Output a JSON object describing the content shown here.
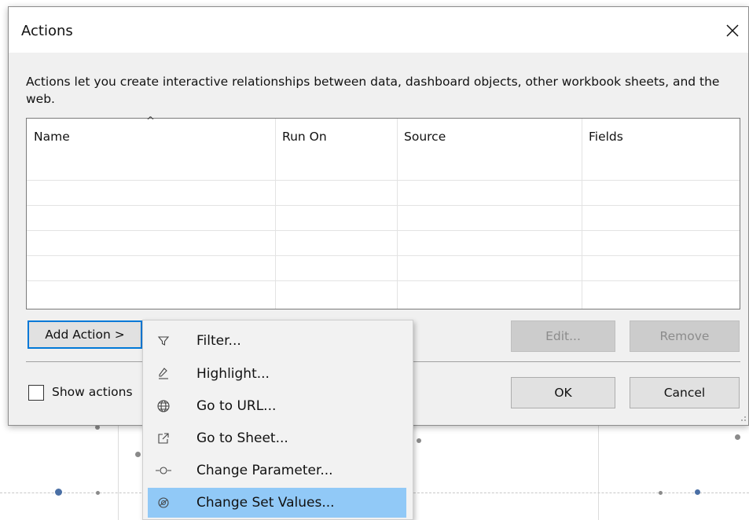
{
  "dialog": {
    "title": "Actions",
    "description": "Actions let you create interactive relationships between data, dashboard objects, other workbook sheets, and the web.",
    "table": {
      "columns": [
        "Name",
        "Run On",
        "Source",
        "Fields"
      ],
      "rows": []
    },
    "buttons": {
      "add_action": "Add Action >",
      "edit": "Edit...",
      "remove": "Remove",
      "ok": "OK",
      "cancel": "Cancel"
    },
    "show_actions_label": "Show actions",
    "show_actions_checked": false
  },
  "menu": {
    "items": [
      {
        "label": "Filter...",
        "icon": "filter-icon"
      },
      {
        "label": "Highlight...",
        "icon": "highlight-icon"
      },
      {
        "label": "Go to URL...",
        "icon": "globe-icon"
      },
      {
        "label": "Go to Sheet...",
        "icon": "external-sheet-icon"
      },
      {
        "label": "Change Parameter...",
        "icon": "parameter-icon"
      },
      {
        "label": "Change Set Values...",
        "icon": "set-values-icon",
        "highlighted": true
      }
    ]
  },
  "colors": {
    "focus_border": "#0078d7",
    "menu_highlight": "#91c9f7",
    "dialog_bg": "#f0f0f0"
  }
}
